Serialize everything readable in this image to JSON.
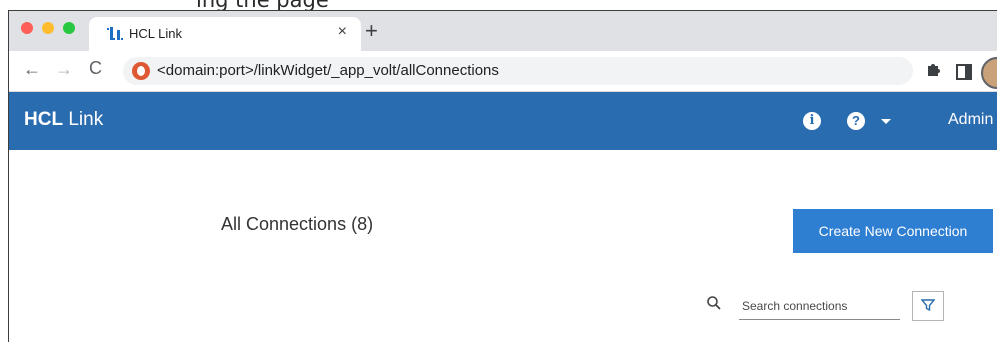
{
  "caption": {
    "text": "ing the page"
  },
  "browser": {
    "tab_title": "HCL Link",
    "tab_close": "×",
    "new_tab": "+",
    "url": "<domain:port>/linkWidget/_app_volt/allConnections",
    "nav": {
      "back": "←",
      "forward": "→",
      "reload": "C"
    },
    "icons": [
      "puzzle-icon",
      "side-panel-icon",
      "profile-avatar"
    ]
  },
  "appbar": {
    "brand_bold": "HCL",
    "brand_rest": " Link",
    "info": "i",
    "help": "?",
    "user": "Admin"
  },
  "main": {
    "title": "All Connections (8)",
    "create_button": "Create New Connection",
    "search_placeholder": "Search connections"
  },
  "colors": {
    "appbar": "#2a6cb0",
    "button": "#2e7ed2",
    "tabstrip": "#dfe1e5"
  }
}
